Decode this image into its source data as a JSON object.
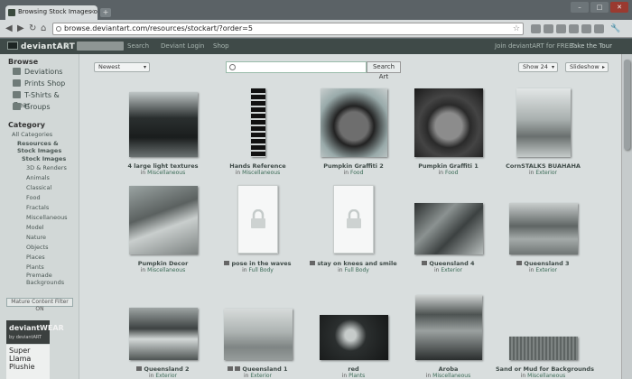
{
  "browser": {
    "tab_title": "Browsing Stock Images on",
    "tab_close": "×",
    "new_tab": "+",
    "url": "browse.deviantart.com/resources/stockart/?order=5",
    "back": "◀",
    "forward": "▶",
    "reload": "↻",
    "home": "⌂",
    "star": "☆",
    "wrench": "🔧",
    "min": "–",
    "max": "□",
    "close": "✕"
  },
  "site_header": {
    "logo": "deviantART",
    "search_label": "Search",
    "login": "Deviant Login",
    "shop": "Shop",
    "join": "Join deviantART for FREE",
    "tour": "Take the Tour"
  },
  "sidebar": {
    "browse_heading": "Browse",
    "browse_items": [
      "Deviations",
      "Prints Shop",
      "T-Shirts & Gear",
      "Groups"
    ],
    "category_heading": "Category",
    "all_categories": "All Categories",
    "resources": "Resources & Stock Images",
    "stock_images": "Stock Images",
    "subcategories": [
      "3D & Renders",
      "Animals",
      "Classical",
      "Food",
      "Fractals",
      "Miscellaneous",
      "Model",
      "Nature",
      "Objects",
      "Places",
      "Plants",
      "Premade Backgrounds"
    ],
    "mature_filter": "Mature Content Filter ON",
    "ad_title": "deviantWEAR",
    "ad_sub": "by deviantART",
    "ad2_text": "Super Llama Plushie"
  },
  "filters": {
    "sort": "Newest",
    "search_button": "Search Art",
    "show": "Show 24",
    "slideshow": "Slideshow"
  },
  "cards": [
    {
      "title": "4 large light textures",
      "in": "in",
      "category": "Miscellaneous",
      "locked": false
    },
    {
      "title": "Hands Reference",
      "in": "in",
      "category": "Miscellaneous",
      "locked": false
    },
    {
      "title": "Pumpkin Graffiti 2",
      "in": "in",
      "category": "Food",
      "locked": false
    },
    {
      "title": "Pumpkin Graffiti 1",
      "in": "in",
      "category": "Food",
      "locked": false
    },
    {
      "title": "CornSTALKS BUAHAHA",
      "in": "in",
      "category": "Exterior",
      "locked": false
    },
    {
      "title": "Pumpkin Decor",
      "in": "in",
      "category": "Miscellaneous",
      "locked": false
    },
    {
      "title": "pose in the waves",
      "in": "in",
      "category": "Full Body",
      "locked": true
    },
    {
      "title": "stay on knees and smile",
      "in": "in",
      "category": "Full Body",
      "locked": true
    },
    {
      "title": "Queensland 4",
      "in": "in",
      "category": "Exterior",
      "locked": false
    },
    {
      "title": "Queensland 3",
      "in": "in",
      "category": "Exterior",
      "locked": false
    },
    {
      "title": "Queensland 2",
      "in": "in",
      "category": "Exterior",
      "locked": false
    },
    {
      "title": "Queensland 1",
      "in": "in",
      "category": "Exterior",
      "locked": false
    },
    {
      "title": "red",
      "in": "in",
      "category": "Plants",
      "locked": false
    },
    {
      "title": "Aroba",
      "in": "in",
      "category": "Miscellaneous",
      "locked": false
    },
    {
      "title": "Sand or Mud for Backgrounds",
      "in": "in",
      "category": "Miscellaneous",
      "locked": false
    }
  ]
}
